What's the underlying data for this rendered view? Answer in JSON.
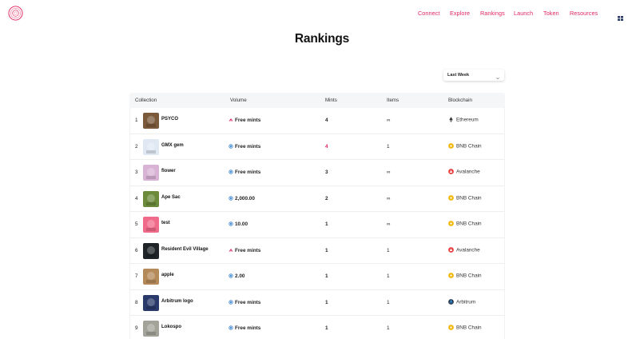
{
  "nav": {
    "links": [
      "Connect",
      "Explore",
      "Rankings",
      "Launch",
      "Token",
      "Resources"
    ]
  },
  "page": {
    "title": "Rankings"
  },
  "filter": {
    "selected": "Last Week"
  },
  "table": {
    "headers": [
      "Collection",
      "Volume",
      "Mints",
      "Items",
      "Blockchain"
    ],
    "rows": [
      {
        "rank": "1",
        "name": "PSYCO",
        "volume": "Free mints",
        "volume_icon": "fire-icon",
        "mints": "4",
        "items": "∞",
        "chain": "Ethereum",
        "chain_icon": "ethereum-icon",
        "thumb_color": "#7a5a3a"
      },
      {
        "rank": "2",
        "name": "GMX gem",
        "volume": "Free mints",
        "volume_icon": "coin-icon",
        "mints": "4",
        "items": "1",
        "chain": "BNB Chain",
        "chain_icon": "bnb-icon",
        "thumb_color": "#dfe8f3"
      },
      {
        "rank": "3",
        "name": "flower",
        "volume": "Free mints",
        "volume_icon": "coin-icon",
        "mints": "3",
        "items": "∞",
        "chain": "Avalanche",
        "chain_icon": "avalanche-icon",
        "thumb_color": "#d9b3d6"
      },
      {
        "rank": "4",
        "name": "Ape Sac",
        "volume": "2,000.00",
        "volume_icon": "coin-icon",
        "mints": "2",
        "items": "∞",
        "chain": "BNB Chain",
        "chain_icon": "bnb-icon",
        "thumb_color": "#6b8a3a"
      },
      {
        "rank": "5",
        "name": "test",
        "volume": "10.00",
        "volume_icon": "coin-icon",
        "mints": "1",
        "items": "∞",
        "chain": "BNB Chain",
        "chain_icon": "bnb-icon",
        "thumb_color": "#f06a8a"
      },
      {
        "rank": "6",
        "name": "Resident Evil Village",
        "volume": "Free mints",
        "volume_icon": "fire-icon",
        "mints": "1",
        "items": "1",
        "chain": "Avalanche",
        "chain_icon": "avalanche-icon",
        "thumb_color": "#1e2428"
      },
      {
        "rank": "7",
        "name": "apple",
        "volume": "2.00",
        "volume_icon": "coin-icon",
        "mints": "1",
        "items": "1",
        "chain": "BNB Chain",
        "chain_icon": "bnb-icon",
        "thumb_color": "#b58a5a"
      },
      {
        "rank": "8",
        "name": "Arbitrum logo",
        "volume": "Free mints",
        "volume_icon": "coin-icon",
        "mints": "1",
        "items": "1",
        "chain": "Arbitrum",
        "chain_icon": "arbitrum-icon",
        "thumb_color": "#2a3a6a"
      },
      {
        "rank": "9",
        "name": "Lokospo",
        "volume": "Free mints",
        "volume_icon": "coin-icon",
        "mints": "1",
        "items": "1",
        "chain": "BNB Chain",
        "chain_icon": "bnb-icon",
        "thumb_color": "#a3a39a"
      }
    ]
  },
  "colors": {
    "accent": "#e0245e",
    "bnb": "#f0b90b",
    "avalanche": "#e84142",
    "arbitrum": "#2d374b",
    "coin": "#4a8fd6"
  }
}
